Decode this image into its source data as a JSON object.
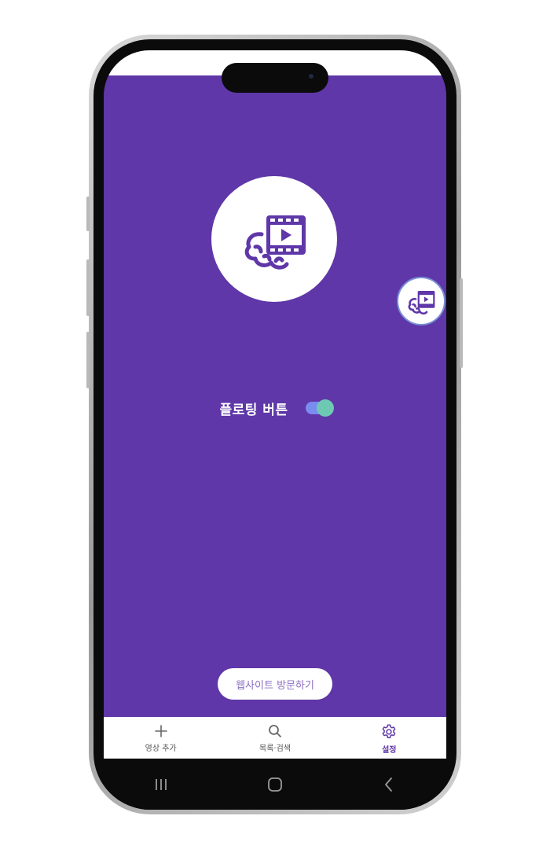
{
  "app": {
    "toggle_label": "플로팅 버튼",
    "toggle_on": true,
    "visit_button": "웹사이트 방문하기",
    "logo_icon": "brain-video-icon",
    "floating_icon": "brain-video-icon"
  },
  "bottom_nav": {
    "items": [
      {
        "label": "영상 추가",
        "icon": "plus-icon",
        "active": false
      },
      {
        "label": "목록·검색",
        "icon": "search-icon",
        "active": false
      },
      {
        "label": "설정",
        "icon": "gear-icon",
        "active": true
      }
    ]
  },
  "system_nav": [
    "recent-apps-icon",
    "home-icon",
    "back-icon"
  ],
  "colors": {
    "primary": "#5f37a8",
    "toggle_track": "#7b8cf0",
    "toggle_knob": "#6ec9b4",
    "button_text": "#8c6fc4",
    "background": "#ffffff"
  }
}
